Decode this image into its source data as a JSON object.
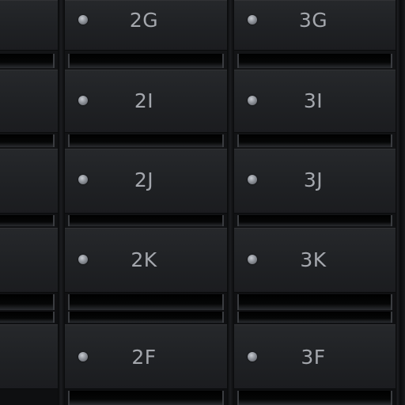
{
  "mailboxes": {
    "middle_column": [
      "2G",
      "2I",
      "2J",
      "2K",
      "2F"
    ],
    "right_column": [
      "3G",
      "3I",
      "3J",
      "3K",
      "3F"
    ]
  },
  "colors": {
    "door": "#222427",
    "label_text": "#a4a7ad",
    "lock": "#9a9da3"
  }
}
